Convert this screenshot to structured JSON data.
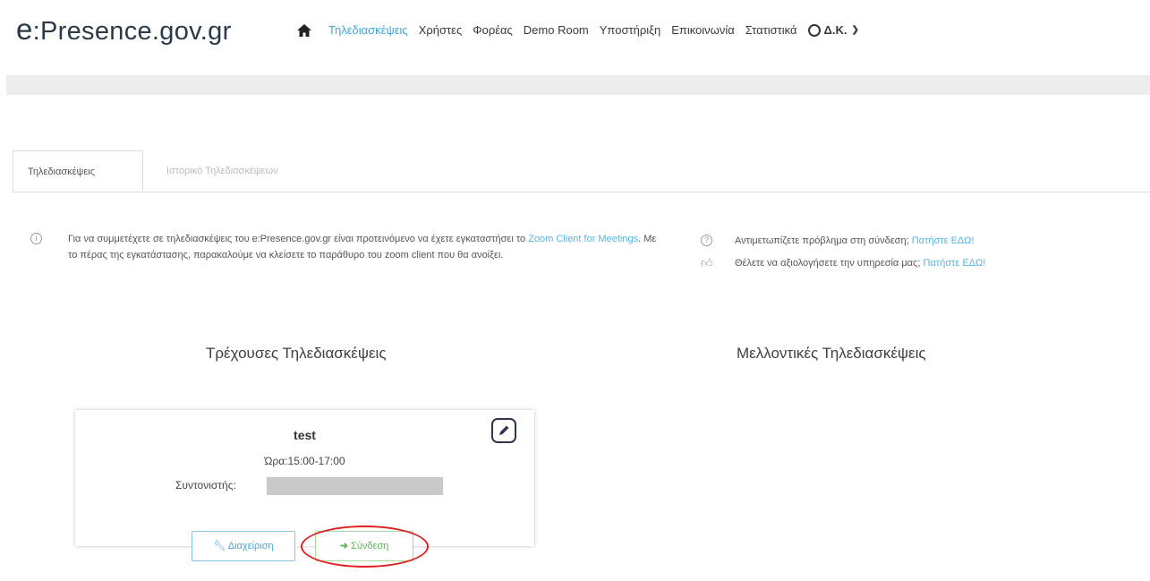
{
  "brand": {
    "logo_e": "e",
    "logo_rest": ":Presence.gov.gr"
  },
  "nav": {
    "items": [
      "Τηλεδιασκέψεις",
      "Χρήστες",
      "Φορέας",
      "Demo Room",
      "Υποστήριξη",
      "Επικοινωνία",
      "Στατιστικά"
    ],
    "user": "Δ.Κ."
  },
  "tabs": {
    "active": "Τηλεδιασκέψεις",
    "inactive": "Ιστορικό Τηλεδιασκέψεων"
  },
  "info": {
    "part1": "Για να συμμετέχετε σε τηλεδιασκέψεις του e:Presence.gov.gr είναι προτεινόμενο να έχετε εγκαταστήσει το ",
    "link": "Zoom Client for Meetings",
    "part2": ". Με το πέρας της εγκατάστασης, παρακαλούμε να κλείσετε το παράθυρο του zoom client που θα ανοίξει."
  },
  "help": {
    "q1": "Αντιμετωπίζετε πρόβλημα στη σύνδεση; ",
    "q2": "Θέλετε να αξιολογήσετε την υπηρεσία μας; ",
    "link": "Πατήστε ΕΔΩ!"
  },
  "current_heading": "Τρέχουσες Τηλεδιασκέψεις",
  "future_heading": "Μελλοντικές Τηλεδιασκέψεις",
  "meeting": {
    "title": "test",
    "time": "Ώρα:15:00-17:00",
    "coordinator_label": "Συντονιστής:",
    "manage_label": "Διαχείριση",
    "connect_label": "Σύνδεση"
  },
  "colors": {
    "accent": "#3ea4d8",
    "connect": "#58b952",
    "highlight_ring": "#e02020"
  }
}
